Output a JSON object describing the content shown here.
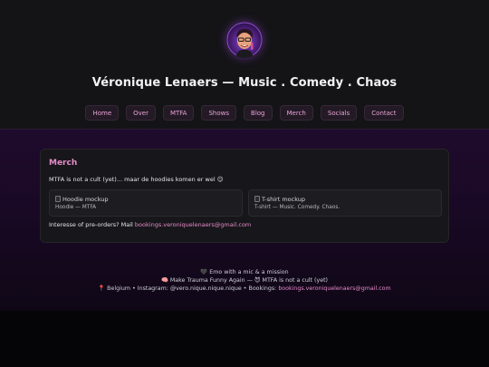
{
  "site": {
    "title": "Véronique Lenaers — Music . Comedy . Chaos",
    "avatar_alt": "avatar"
  },
  "nav": [
    {
      "label": "Home"
    },
    {
      "label": "Over"
    },
    {
      "label": "MTFA"
    },
    {
      "label": "Shows"
    },
    {
      "label": "Blog"
    },
    {
      "label": "Merch"
    },
    {
      "label": "Socials"
    },
    {
      "label": "Contact"
    }
  ],
  "merch": {
    "title": "Merch",
    "intro": "MTFA is not a cult (yet)... maar de hoodies komen er wel 😉",
    "items": [
      {
        "image_alt": "Hoodie mockup",
        "caption": "Hoodie — MTFA"
      },
      {
        "image_alt": "T-shirt mockup",
        "caption": "T-shirt — Music. Comedy. Chaos."
      }
    ],
    "preorder_text": "Interesse of pre-orders? Mail ",
    "preorder_email": "bookings.veroniquelenaers@gmail.com"
  },
  "footer": {
    "line1": "🖤 Emo with a mic & a mission",
    "line2": "🧠 Make Trauma Funny Again — 😈 MTFA is not a cult (yet)",
    "line3_prefix": "📍 Belgium • Instagram: @vero.nique.nique.nique • Bookings: ",
    "line3_email": "bookings.veroniquelenaers@gmail.com"
  },
  "colors": {
    "accent": "#e58cc9",
    "header_bg": "#141416",
    "band_bg": "#1f0b2c",
    "card_bg": "#17161a"
  }
}
